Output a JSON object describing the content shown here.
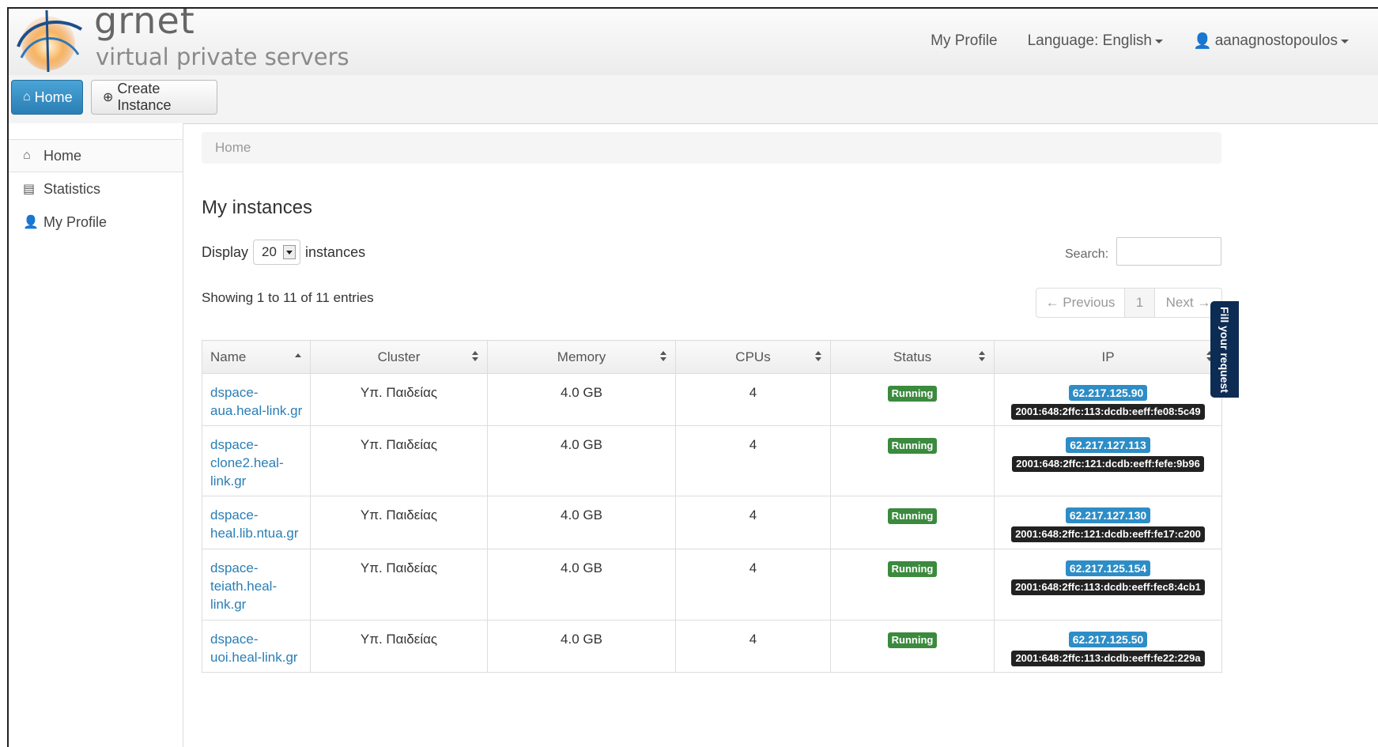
{
  "brand": {
    "name": "grnet",
    "tagline": "virtual private servers"
  },
  "topnav": {
    "my_profile": "My Profile",
    "language": "Language: English",
    "user": "aanagnostopoulos"
  },
  "toolbar": {
    "home": "Home",
    "create": "Create Instance"
  },
  "sidebar": {
    "items": [
      {
        "label": "Home"
      },
      {
        "label": "Statistics"
      },
      {
        "label": "My Profile"
      }
    ]
  },
  "breadcrumb": "Home",
  "page": {
    "title": "My instances",
    "display_prefix": "Display",
    "display_value": "20",
    "display_suffix": "instances",
    "search_label": "Search:",
    "info": "Showing 1 to 11 of 11 entries"
  },
  "pager": {
    "previous": "← Previous",
    "page": "1",
    "next": "Next →"
  },
  "table": {
    "columns": [
      "Name",
      "Cluster",
      "Memory",
      "CPUs",
      "Status",
      "IP"
    ],
    "rows": [
      {
        "name": [
          "dspace-",
          "aua.heal-link.gr"
        ],
        "cluster": "Υπ. Παιδείας",
        "memory": "4.0 GB",
        "cpus": "4",
        "status": "Running",
        "ipv4": "62.217.125.90",
        "ipv6": "2001:648:2ffc:113:dcdb:eeff:fe08:5c49"
      },
      {
        "name": [
          "dspace-",
          "clone2.heal-",
          "link.gr"
        ],
        "cluster": "Υπ. Παιδείας",
        "memory": "4.0 GB",
        "cpus": "4",
        "status": "Running",
        "ipv4": "62.217.127.113",
        "ipv6": "2001:648:2ffc:121:dcdb:eeff:fefe:9b96"
      },
      {
        "name": [
          "dspace-",
          "heal.lib.ntua.gr"
        ],
        "cluster": "Υπ. Παιδείας",
        "memory": "4.0 GB",
        "cpus": "4",
        "status": "Running",
        "ipv4": "62.217.127.130",
        "ipv6": "2001:648:2ffc:121:dcdb:eeff:fe17:c200"
      },
      {
        "name": [
          "dspace-",
          "teiath.heal-",
          "link.gr"
        ],
        "cluster": "Υπ. Παιδείας",
        "memory": "4.0 GB",
        "cpus": "4",
        "status": "Running",
        "ipv4": "62.217.125.154",
        "ipv6": "2001:648:2ffc:113:dcdb:eeff:fec8:4cb1"
      },
      {
        "name": [
          "dspace-",
          "uoi.heal-link.gr"
        ],
        "cluster": "Υπ. Παιδείας",
        "memory": "4.0 GB",
        "cpus": "4",
        "status": "Running",
        "ipv4": "62.217.125.50",
        "ipv6": "2001:648:2ffc:113:dcdb:eeff:fe22:229a"
      }
    ]
  },
  "feedback_tab": "Fill your request",
  "colors": {
    "primary": "#2a7eb5",
    "running": "#3b8a3e",
    "ipv4": "#2d8dc6",
    "ipv6": "#222222",
    "feedback": "#0d2c54"
  }
}
